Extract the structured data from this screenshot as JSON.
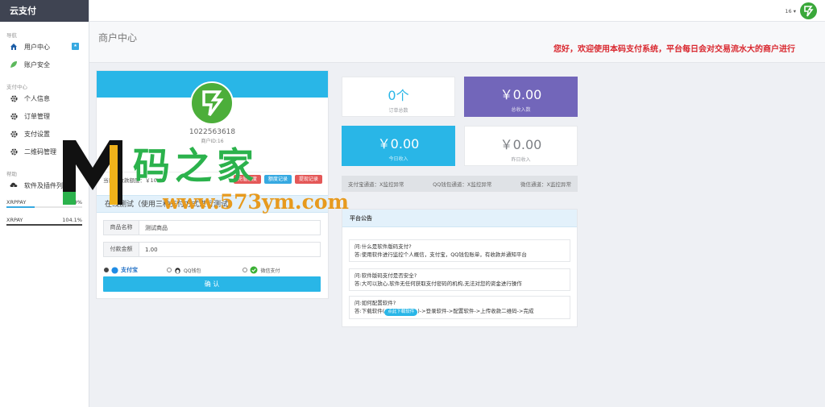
{
  "app": {
    "brand": "云支付"
  },
  "sidebar": {
    "nav_section": "导航",
    "items_nav": [
      {
        "label": "用户中心",
        "icon": "home-icon",
        "badge": "★"
      },
      {
        "label": "账户安全",
        "icon": "leaf-icon"
      }
    ],
    "pay_section": "支付中心",
    "items_pay": [
      {
        "label": "个人信息",
        "icon": "gear-icon"
      },
      {
        "label": "订单管理",
        "icon": "gear-icon"
      },
      {
        "label": "支付设置",
        "icon": "gear-icon"
      },
      {
        "label": "二维码管理",
        "icon": "gear-icon"
      }
    ],
    "help_section": "帮助",
    "items_help": [
      {
        "label": "软件及插件列表",
        "icon": "cloud-download-icon"
      }
    ],
    "progress": [
      {
        "label": "XRPPAY",
        "value": "36.9%",
        "fraction": 0.369
      },
      {
        "label": "XRPAY",
        "value": "104.1%",
        "fraction": 1.0
      }
    ]
  },
  "topbar": {
    "user_id": "16 ▾"
  },
  "header": {
    "title": "商户中心",
    "marquee": "您好，欢迎使用本码支付系统，平台每日会对交易流水大的商户进行"
  },
  "profile": {
    "qq": "1022563618",
    "uid": "商户ID:16",
    "limit_label": "当日可收款额度：￥10.00",
    "btn_recharge": "充值额度",
    "btn_b": "额度记录",
    "btn_c": "提现记录"
  },
  "test_pay": {
    "title": "在线测试（使用三种支付方式进行测试）",
    "name_label": "商品名称",
    "name_value": "测试商品",
    "amount_label": "付款金额",
    "amount_value": "1.00",
    "methods": [
      "支付宝",
      "QQ钱包",
      "微信支付"
    ],
    "confirm": "确 认"
  },
  "stats": [
    {
      "value": "0个",
      "label": "订单总数"
    },
    {
      "value": "￥0.00",
      "label": "总收入数"
    },
    {
      "value": "￥0.00",
      "label": "今日收入"
    },
    {
      "value": "￥0.00",
      "label": "昨日收入"
    }
  ],
  "channels": [
    "支付宝通道：X监控异常",
    "QQ钱包通道：X监控异常",
    "微信通道：X监控异常"
  ],
  "notice": {
    "title": "平台公告",
    "qa": [
      {
        "q": "问:什么是软件版码支付?",
        "a": "答:使用软件进行监控个人概信，支付宝，QQ钱包账单，有收款并通知平台"
      },
      {
        "q": "问:软件版码支付是否安全?",
        "a": "答:大可以放心,软件无任何获取支付密码的机构,无法对您的资金进行操作"
      },
      {
        "q": "问:如何配置软件?",
        "a_pre": "答:下载软件(",
        "a_btn": "点此下载软件",
        "a_post": ")->登录软件->配置软件->上传收款二维码->完成"
      }
    ]
  },
  "watermark": {
    "cn": "码之家",
    "url": "www.573ym.com"
  },
  "colors": {
    "accent": "#29b6e7",
    "purple": "#7266ba",
    "alert": "#d9272e",
    "sidebar_brand": "#3f4452"
  }
}
